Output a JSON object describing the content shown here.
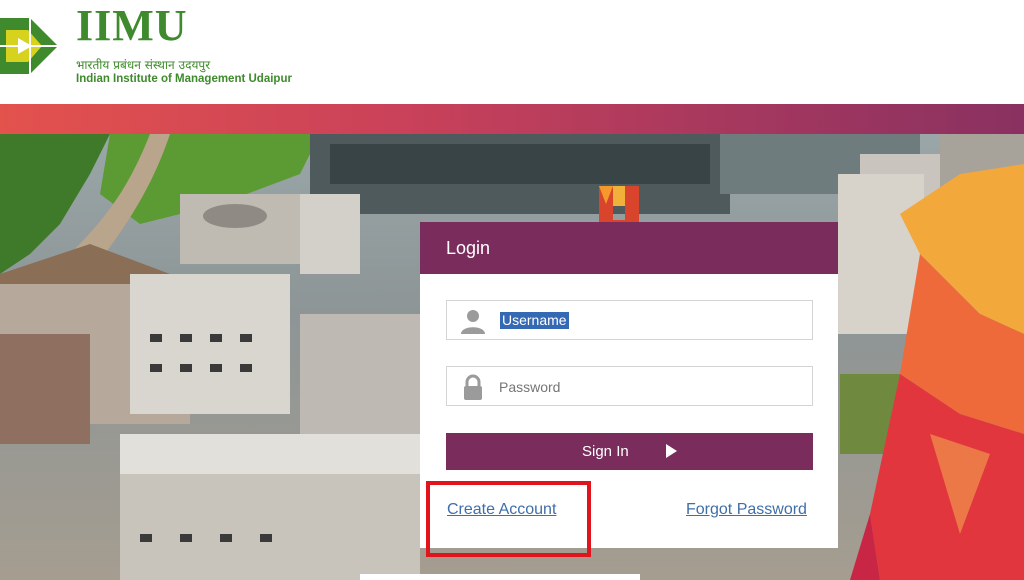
{
  "header": {
    "brand_title": "IIMU",
    "brand_hindi": "भारतीय प्रबंधन संस्थान उदयपुर",
    "brand_subtitle": "Indian Institute of Management Udaipur",
    "logo_icon": "iimu-logo-icon"
  },
  "login": {
    "title": "Login",
    "username": {
      "value": "Username",
      "icon": "user-icon"
    },
    "password": {
      "placeholder": "Password",
      "icon": "lock-icon"
    },
    "sign_in_label": "Sign In",
    "sign_in_icon": "play-arrow-icon",
    "create_account": "Create Account",
    "forgot_password": "Forgot Password"
  },
  "colors": {
    "brand_green": "#3e8a2c",
    "panel_header": "#7a2c5d",
    "link": "#3f6ea8",
    "annotation_red": "#e1141d"
  }
}
